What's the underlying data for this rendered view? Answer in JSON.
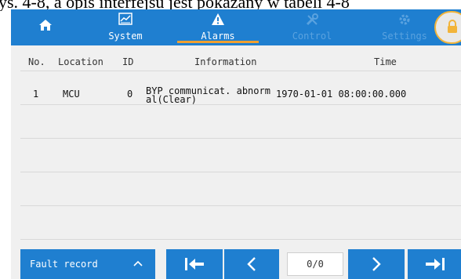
{
  "document_header_text": "ys. 4-8, a opis interfejsu jest pokazany w tabeli 4-8",
  "nav": {
    "home_icon": "home-icon",
    "tabs": [
      {
        "label": "System",
        "icon": "chart-icon",
        "state": "normal"
      },
      {
        "label": "Alarms",
        "icon": "warning-icon",
        "state": "active"
      },
      {
        "label": "Control",
        "icon": "tools-icon",
        "state": "disabled"
      },
      {
        "label": "Settings",
        "icon": "gear-icon",
        "state": "disabled"
      }
    ],
    "lock_icon": "lock-icon",
    "colors": {
      "bar": "#1f7fd0",
      "active_underline": "#f0a030",
      "disabled_text": "#5aa2df"
    }
  },
  "table": {
    "headers": {
      "no": "No.",
      "location": "Location",
      "id": "ID",
      "information": "Information",
      "time": "Time"
    },
    "rows": [
      {
        "no": "1",
        "location": "MCU",
        "id": "0",
        "information": "BYP communicat. abnormal(Clear)",
        "time": "1970-01-01 08:00:00.000"
      }
    ]
  },
  "footer": {
    "record_type": "Fault record",
    "record_chevron": "chevron-up-icon",
    "first_icon": "first-page-icon",
    "prev_icon": "prev-page-icon",
    "page_indicator": "0/0",
    "next_icon": "next-page-icon",
    "last_icon": "last-page-icon"
  }
}
